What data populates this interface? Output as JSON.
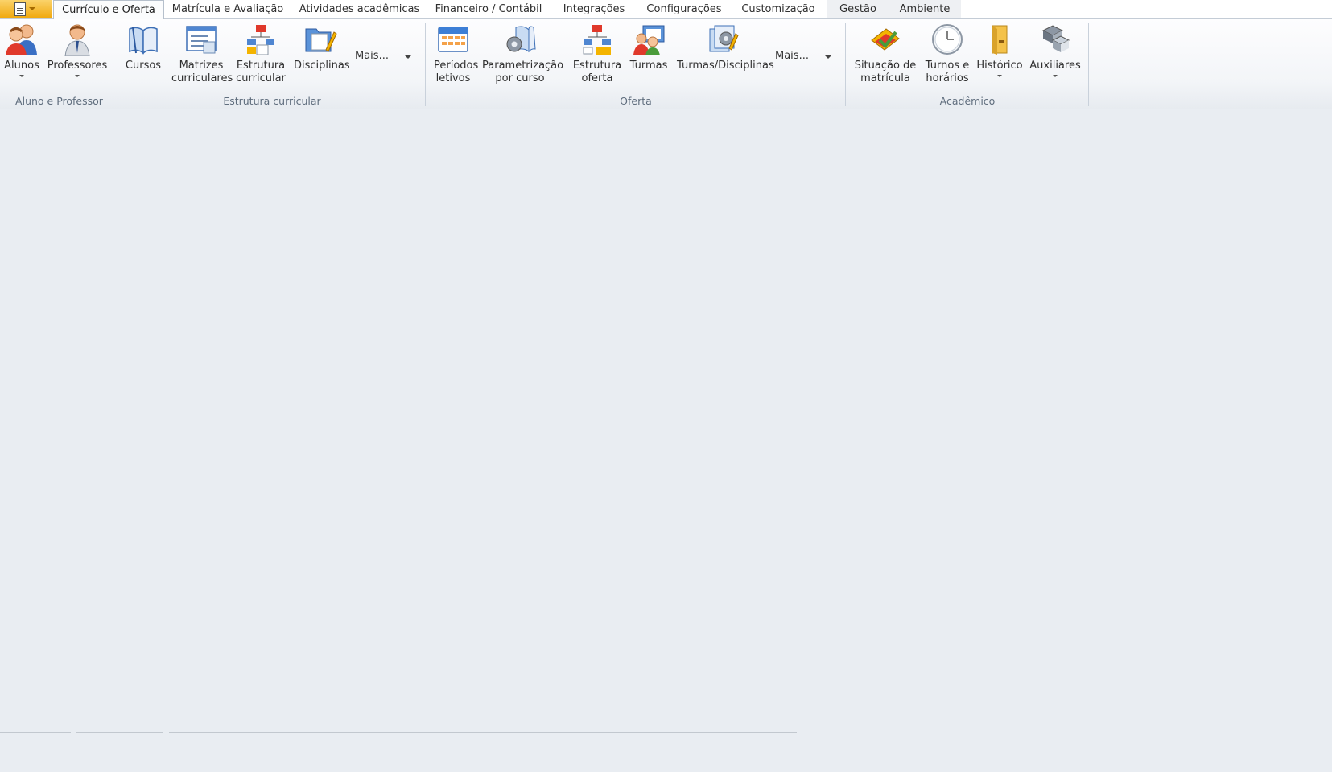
{
  "tabs": [
    {
      "label": "Currículo e Oferta",
      "active": true
    },
    {
      "label": "Matrícula e Avaliação"
    },
    {
      "label": "Atividades acadêmicas"
    },
    {
      "label": "Financeiro / Contábil"
    },
    {
      "label": "Integrações"
    },
    {
      "label": "Configurações"
    },
    {
      "label": "Customização"
    },
    {
      "label": "Gestão"
    },
    {
      "label": "Ambiente"
    }
  ],
  "groups": {
    "aluno": {
      "label": "Aluno e Professor",
      "buttons": {
        "alunos": {
          "line1": "Alunos",
          "icon": "students-icon"
        },
        "professores": {
          "line1": "Professores",
          "icon": "teacher-icon"
        }
      }
    },
    "estrutura": {
      "label": "Estrutura curricular",
      "buttons": {
        "cursos": {
          "line1": "Cursos",
          "icon": "book-icon"
        },
        "matrizes": {
          "line1": "Matrizes",
          "line2": "curriculares",
          "icon": "matrix-icon"
        },
        "estrutura": {
          "line1": "Estrutura",
          "line2": "curricular",
          "icon": "structure-icon"
        },
        "disciplinas": {
          "line1": "Disciplinas",
          "icon": "folder-edit-icon"
        }
      },
      "more": "Mais..."
    },
    "oferta": {
      "label": "Oferta",
      "buttons": {
        "periodos": {
          "line1": "Períodos",
          "line2": "letivos",
          "icon": "calendar-icon"
        },
        "parametrizacao": {
          "line1": "Parametrização",
          "line2": "por curso",
          "icon": "gear-book-icon"
        },
        "estrutura_oferta": {
          "line1": "Estrutura",
          "line2": "oferta",
          "icon": "structure-icon"
        },
        "turmas": {
          "line1": "Turmas",
          "icon": "class-icon"
        },
        "turmas_disciplinas": {
          "line1": "Turmas/Disciplinas",
          "icon": "class-subject-icon"
        }
      },
      "more": "Mais..."
    },
    "academico": {
      "label": "Acadêmico",
      "buttons": {
        "situacao": {
          "line1": "Situação de",
          "line2": "matrícula",
          "icon": "status-icon"
        },
        "turnos": {
          "line1": "Turnos e",
          "line2": "horários",
          "icon": "clock-icon"
        },
        "historico": {
          "line1": "Histórico",
          "icon": "file-cabinet-icon"
        },
        "auxiliares": {
          "line1": "Auxiliares",
          "icon": "tools-icon"
        }
      }
    }
  },
  "colors": {
    "app_button": "#f0a70c",
    "background": "#e9edf2"
  }
}
